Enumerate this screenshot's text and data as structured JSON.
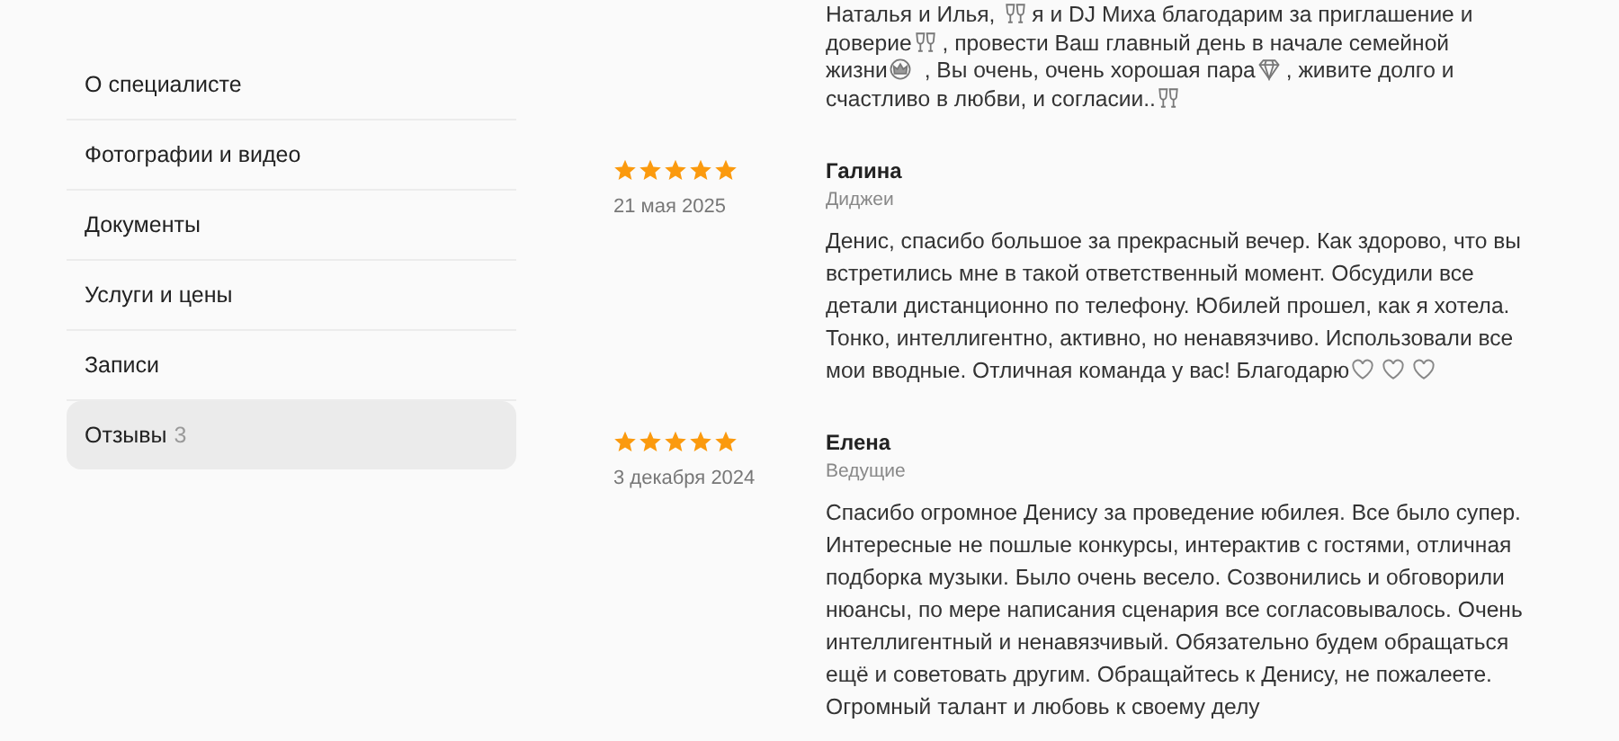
{
  "sidebar": {
    "items": [
      {
        "label": "О специалисте",
        "selected": false
      },
      {
        "label": "Фотографии и видео",
        "selected": false
      },
      {
        "label": "Документы",
        "selected": false
      },
      {
        "label": "Услуги и цены",
        "selected": false
      },
      {
        "label": "Записи",
        "selected": false
      },
      {
        "label": "Отзывы",
        "count": "3",
        "selected": true
      }
    ]
  },
  "reviews": [
    {
      "text": [
        {
          "kind": "text",
          "text": "Наталья и Илья, "
        },
        {
          "kind": "glasses"
        },
        {
          "kind": "text",
          "text": "я и DJ Миха благодарим за приглашение и доверие"
        },
        {
          "kind": "glasses"
        },
        {
          "kind": "text",
          "text": ", провести Ваш главный день в начале семейной жизни"
        },
        {
          "kind": "crown"
        },
        {
          "kind": "text",
          "text": " , Вы очень, очень хорошая пара"
        },
        {
          "kind": "gem"
        },
        {
          "kind": "text",
          "text": ", живите долго и счастливо в любви, и согласии.."
        },
        {
          "kind": "glasses"
        }
      ]
    },
    {
      "stars": 5,
      "date": "21 мая 2025",
      "author": "Галина",
      "role": "Диджеи",
      "text": [
        {
          "kind": "text",
          "text": "Денис, спасибо большое за прекрасный вечер. Как здорово, что вы встретились мне в такой ответственный момент. Обсудили все детали дистанционно по телефону. Юбилей прошел, как я хотела. Тонко, интеллигентно, активно, но ненавязчиво. Использовали все мои вводные. Отличная команда у вас! Благодарю"
        },
        {
          "kind": "heart"
        },
        {
          "kind": "heart"
        },
        {
          "kind": "heart"
        }
      ]
    },
    {
      "stars": 5,
      "date": "3 декабря 2024",
      "author": "Елена",
      "role": "Ведущие",
      "text": [
        {
          "kind": "text",
          "text": "Спасибо огромное Денису за проведение юбилея. Все было супер. Интересные не пошлые конкурсы, интерактив с гостями, отличная подборка музыки. Было очень весело. Созвонились и обговорили нюансы, по мере написания сценария все согласовывалось. Очень интеллигентный и ненавязчивый. Обязательно будем обращаться ещё и советовать другим. Обращайтесь к Денису, не пожалеете. Огромный талант и любовь к своему делу"
        }
      ]
    }
  ]
}
